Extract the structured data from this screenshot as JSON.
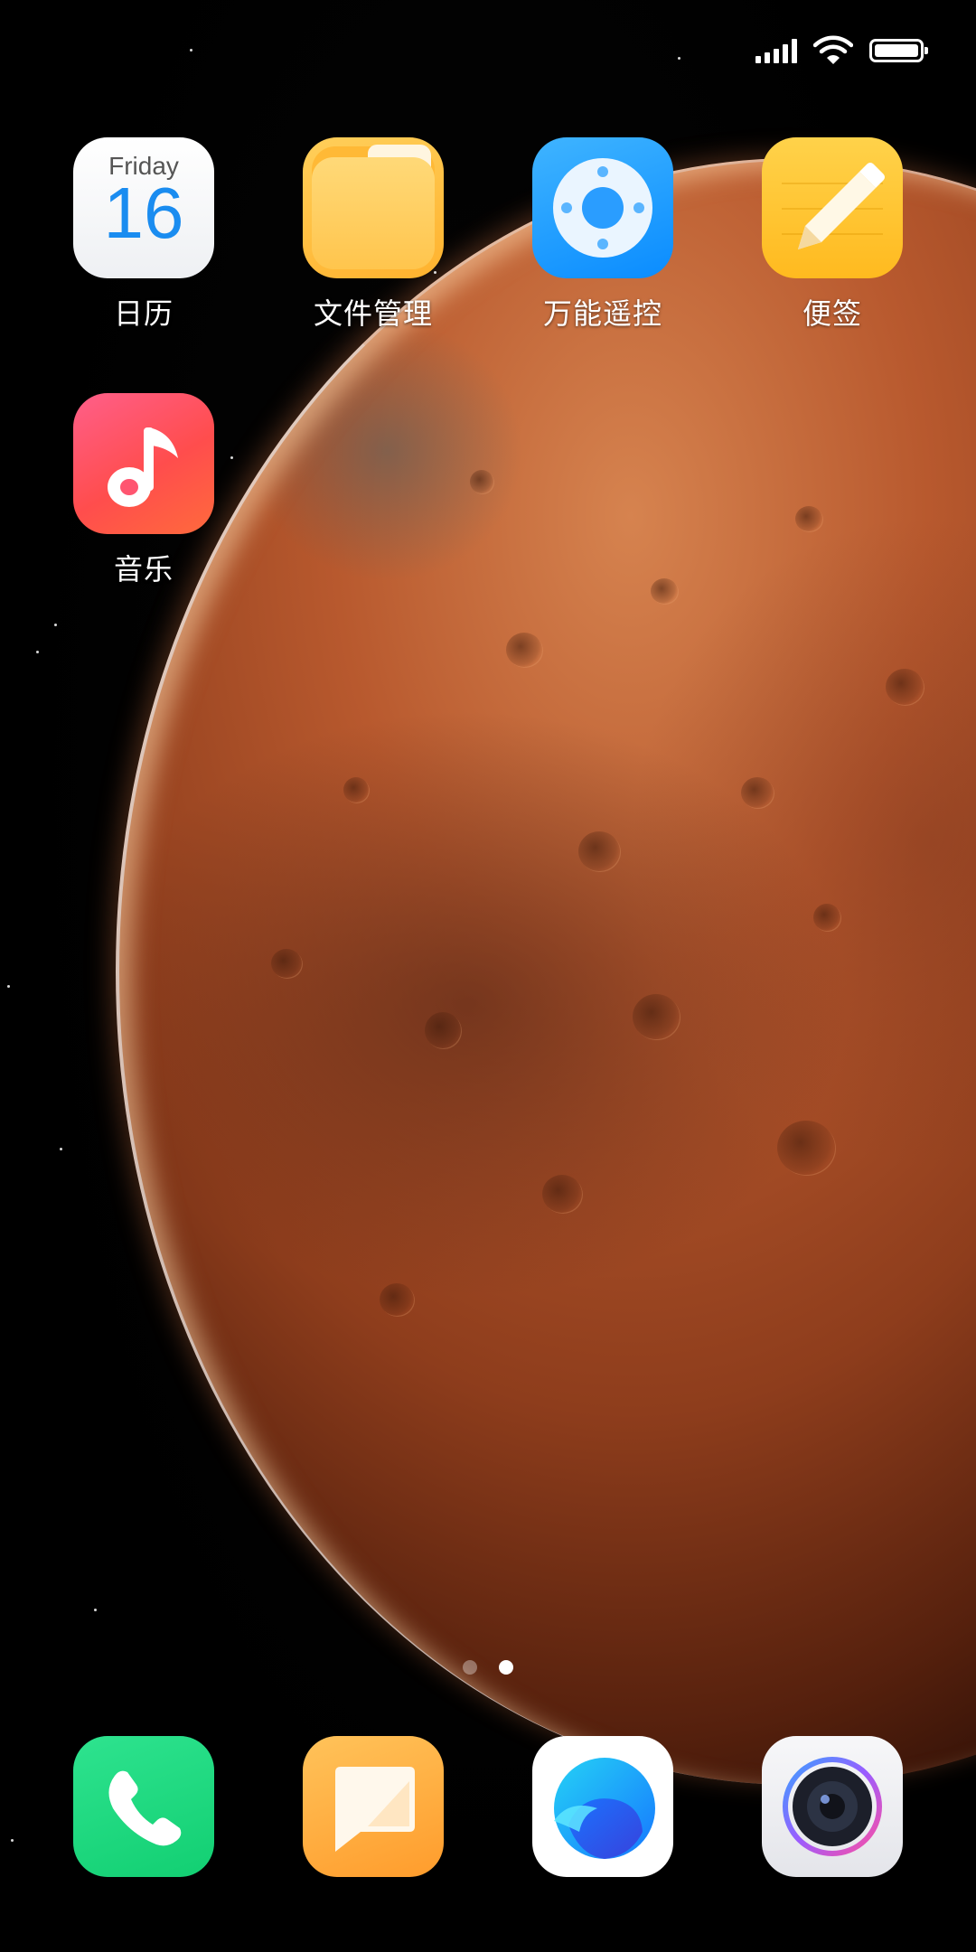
{
  "status_bar": {
    "signal_icon": "cellular-signal-icon",
    "wifi_icon": "wifi-icon",
    "battery_icon": "battery-full-icon"
  },
  "wallpaper": "mars-planet",
  "home_apps": [
    {
      "label": "日历",
      "icon": "calendar-icon",
      "day": "Friday",
      "date": "16"
    },
    {
      "label": "文件管理",
      "icon": "folder-icon"
    },
    {
      "label": "万能遥控",
      "icon": "remote-control-icon"
    },
    {
      "label": "便签",
      "icon": "notes-pencil-icon"
    },
    {
      "label": "音乐",
      "icon": "music-note-icon"
    }
  ],
  "page_indicator": {
    "pages": 2,
    "current": 2
  },
  "dock": [
    {
      "icon": "phone-icon"
    },
    {
      "icon": "messages-icon"
    },
    {
      "icon": "browser-icon"
    },
    {
      "icon": "camera-icon"
    }
  ],
  "colors": {
    "calendar_date": "#1a8cf0",
    "files": "#ffc54d",
    "remote": "#0a8cff",
    "notes": "#ffba1f",
    "music": "#ff4d6d",
    "phone": "#12cf72",
    "messages": "#ff9c2c"
  }
}
